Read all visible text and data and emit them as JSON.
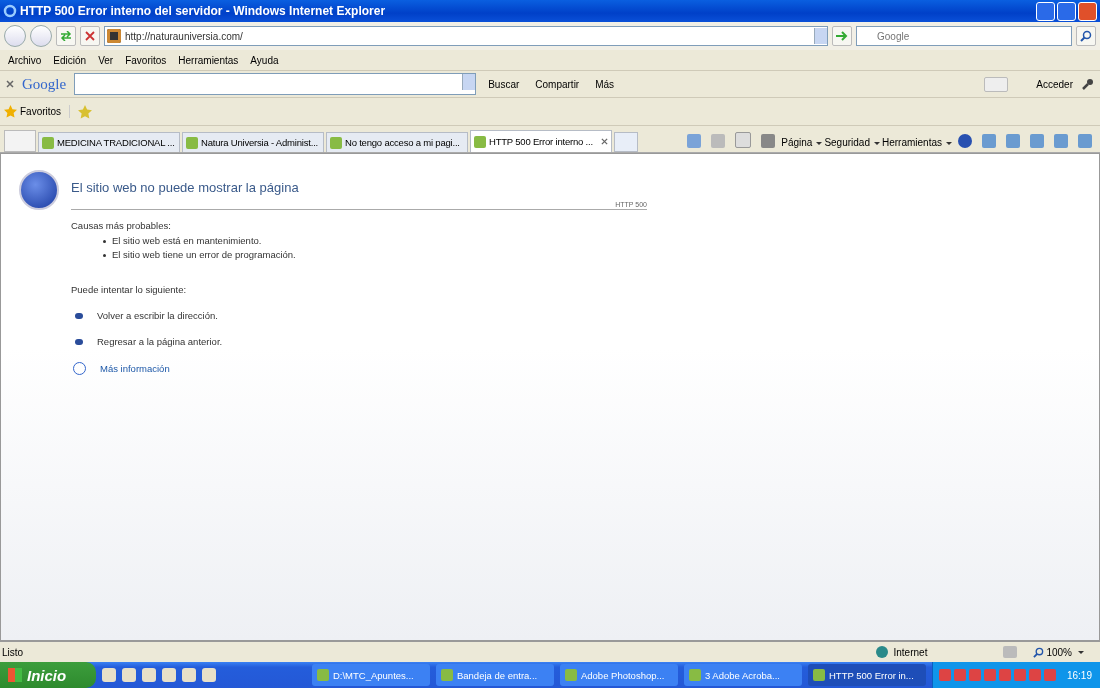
{
  "window": {
    "title": "HTTP 500 Error interno del servidor - Windows Internet Explorer"
  },
  "address": {
    "url": "http://naturauniversia.com/"
  },
  "search": {
    "placeholder": "Google"
  },
  "menu": [
    "Archivo",
    "Edición",
    "Ver",
    "Favoritos",
    "Herramientas",
    "Ayuda"
  ],
  "google_bar": {
    "logo": "Google",
    "buttons": [
      "Buscar",
      "Compartir",
      "Más"
    ],
    "signin": "Acceder"
  },
  "favorites_bar": {
    "label": "Favoritos"
  },
  "tabs": [
    {
      "label": "MEDICINA TRADICIONAL ...",
      "selected": false
    },
    {
      "label": "Natura Universia - Administ...",
      "selected": false
    },
    {
      "label": "No tengo acceso a mi pagi...",
      "selected": false
    },
    {
      "label": "HTTP 500 Error interno ...",
      "selected": true
    }
  ],
  "command_bar": [
    "Página",
    "Seguridad",
    "Herramientas"
  ],
  "content": {
    "title": "El sitio web no puede mostrar la página",
    "code": "HTTP 500",
    "causes_heading": "Causas más probables:",
    "causes": [
      "El sitio web está en mantenimiento.",
      "El sitio web tiene un error de programación."
    ],
    "try_heading": "Puede intentar lo siguiente:",
    "suggestions": [
      "Volver a escribir la dirección.",
      "Regresar a la página anterior."
    ],
    "more_info": "Más información"
  },
  "status_bar": {
    "text": "Listo",
    "zone": "Internet",
    "zoom": "100%"
  },
  "taskbar": {
    "start": "Inicio",
    "tasks": [
      {
        "label": "D:\\MTC_Apuntes...",
        "selected": false
      },
      {
        "label": "Bandeja de entra...",
        "selected": false
      },
      {
        "label": "Adobe Photoshop...",
        "selected": false
      },
      {
        "label": "3 Adobe Acroba...",
        "selected": false
      },
      {
        "label": "HTTP 500 Error in...",
        "selected": true
      }
    ],
    "clock": "16:19"
  }
}
